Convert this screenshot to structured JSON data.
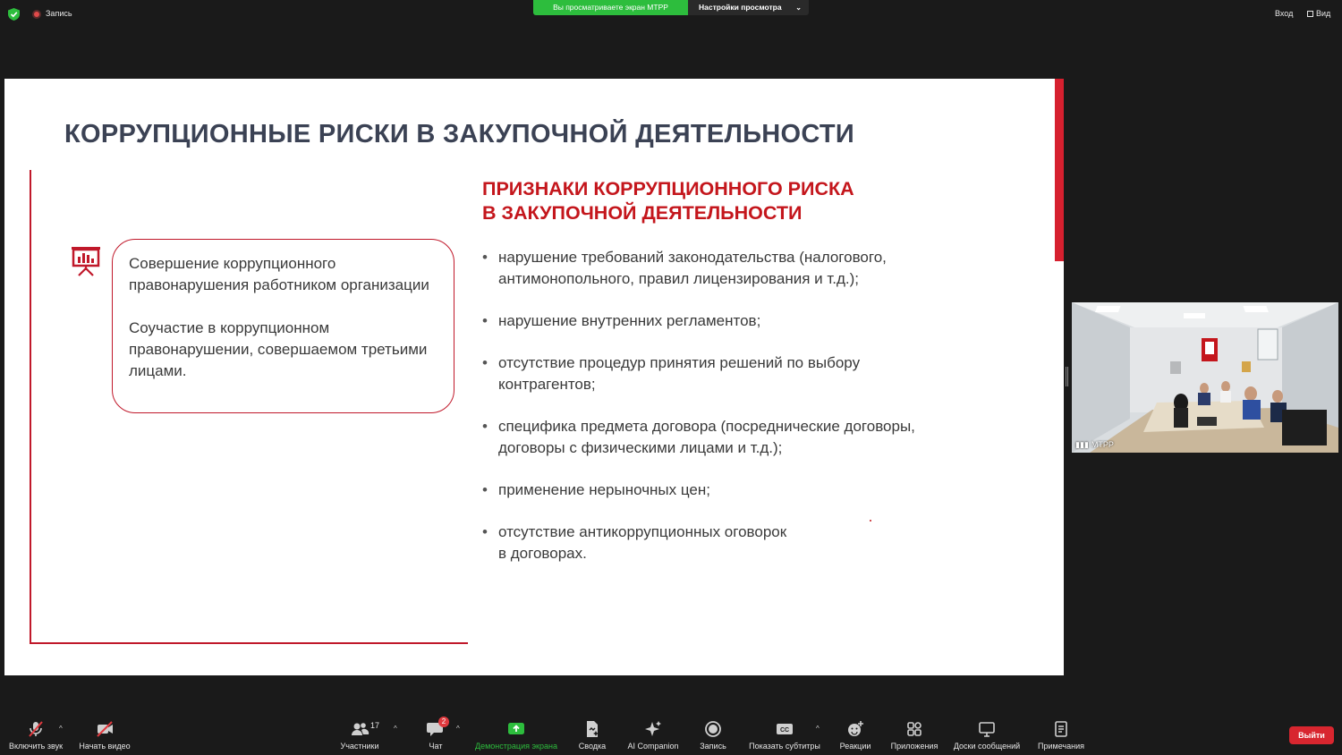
{
  "topbar": {
    "recording_label": "Запись",
    "viewing_banner": "Вы просматриваете экран МТРР",
    "view_settings_label": "Настройки просмотра",
    "sign_in_label": "Вход",
    "view_label": "Вид"
  },
  "slide": {
    "title": "КОРРУПЦИОННЫЕ РИСКИ В ЗАКУПОЧНОЙ ДЕЯТЕЛЬНОСТИ",
    "callout": {
      "paragraph1": "Совершение коррупционного правонарушения работником организации",
      "paragraph2": "Соучастие в коррупционном правонарушении, совершаемом третьими лицами."
    },
    "section_title_line1": "ПРИЗНАКИ КОРРУПЦИОННОГО РИСКА",
    "section_title_line2": "В ЗАКУПОЧНОЙ ДЕЯТЕЛЬНОСТИ",
    "risks": [
      "нарушение требований законодательства (налогового,\nантимонопольного, правил лицензирования и т.д.);",
      "нарушение внутренних регламентов;",
      "отсутствие процедур принятия решений по выбору\nконтрагентов;",
      "специфика предмета договора (посреднические договоры,\nдоговоры с физическими лицами и т.д.);",
      "применение нерыночных цен;",
      "отсутствие антикоррупционных оговорок\nв договорах."
    ],
    "accent_color": "#c4161c",
    "title_color": "#3b4254"
  },
  "video_tile": {
    "participant_name": "МТРР"
  },
  "toolbar": {
    "unmute_label": "Включить звук",
    "start_video_label": "Начать видео",
    "participants_label": "Участники",
    "participants_count": "17",
    "chat_label": "Чат",
    "chat_unread": "2",
    "share_screen_label": "Демонстрация экрана",
    "summary_label": "Сводка",
    "ai_companion_label": "AI Companion",
    "record_label": "Запись",
    "captions_label": "Показать субтитры",
    "reactions_label": "Реакции",
    "apps_label": "Приложения",
    "whiteboards_label": "Доски сообщений",
    "notes_label": "Примечания",
    "leave_label": "Выйти"
  }
}
